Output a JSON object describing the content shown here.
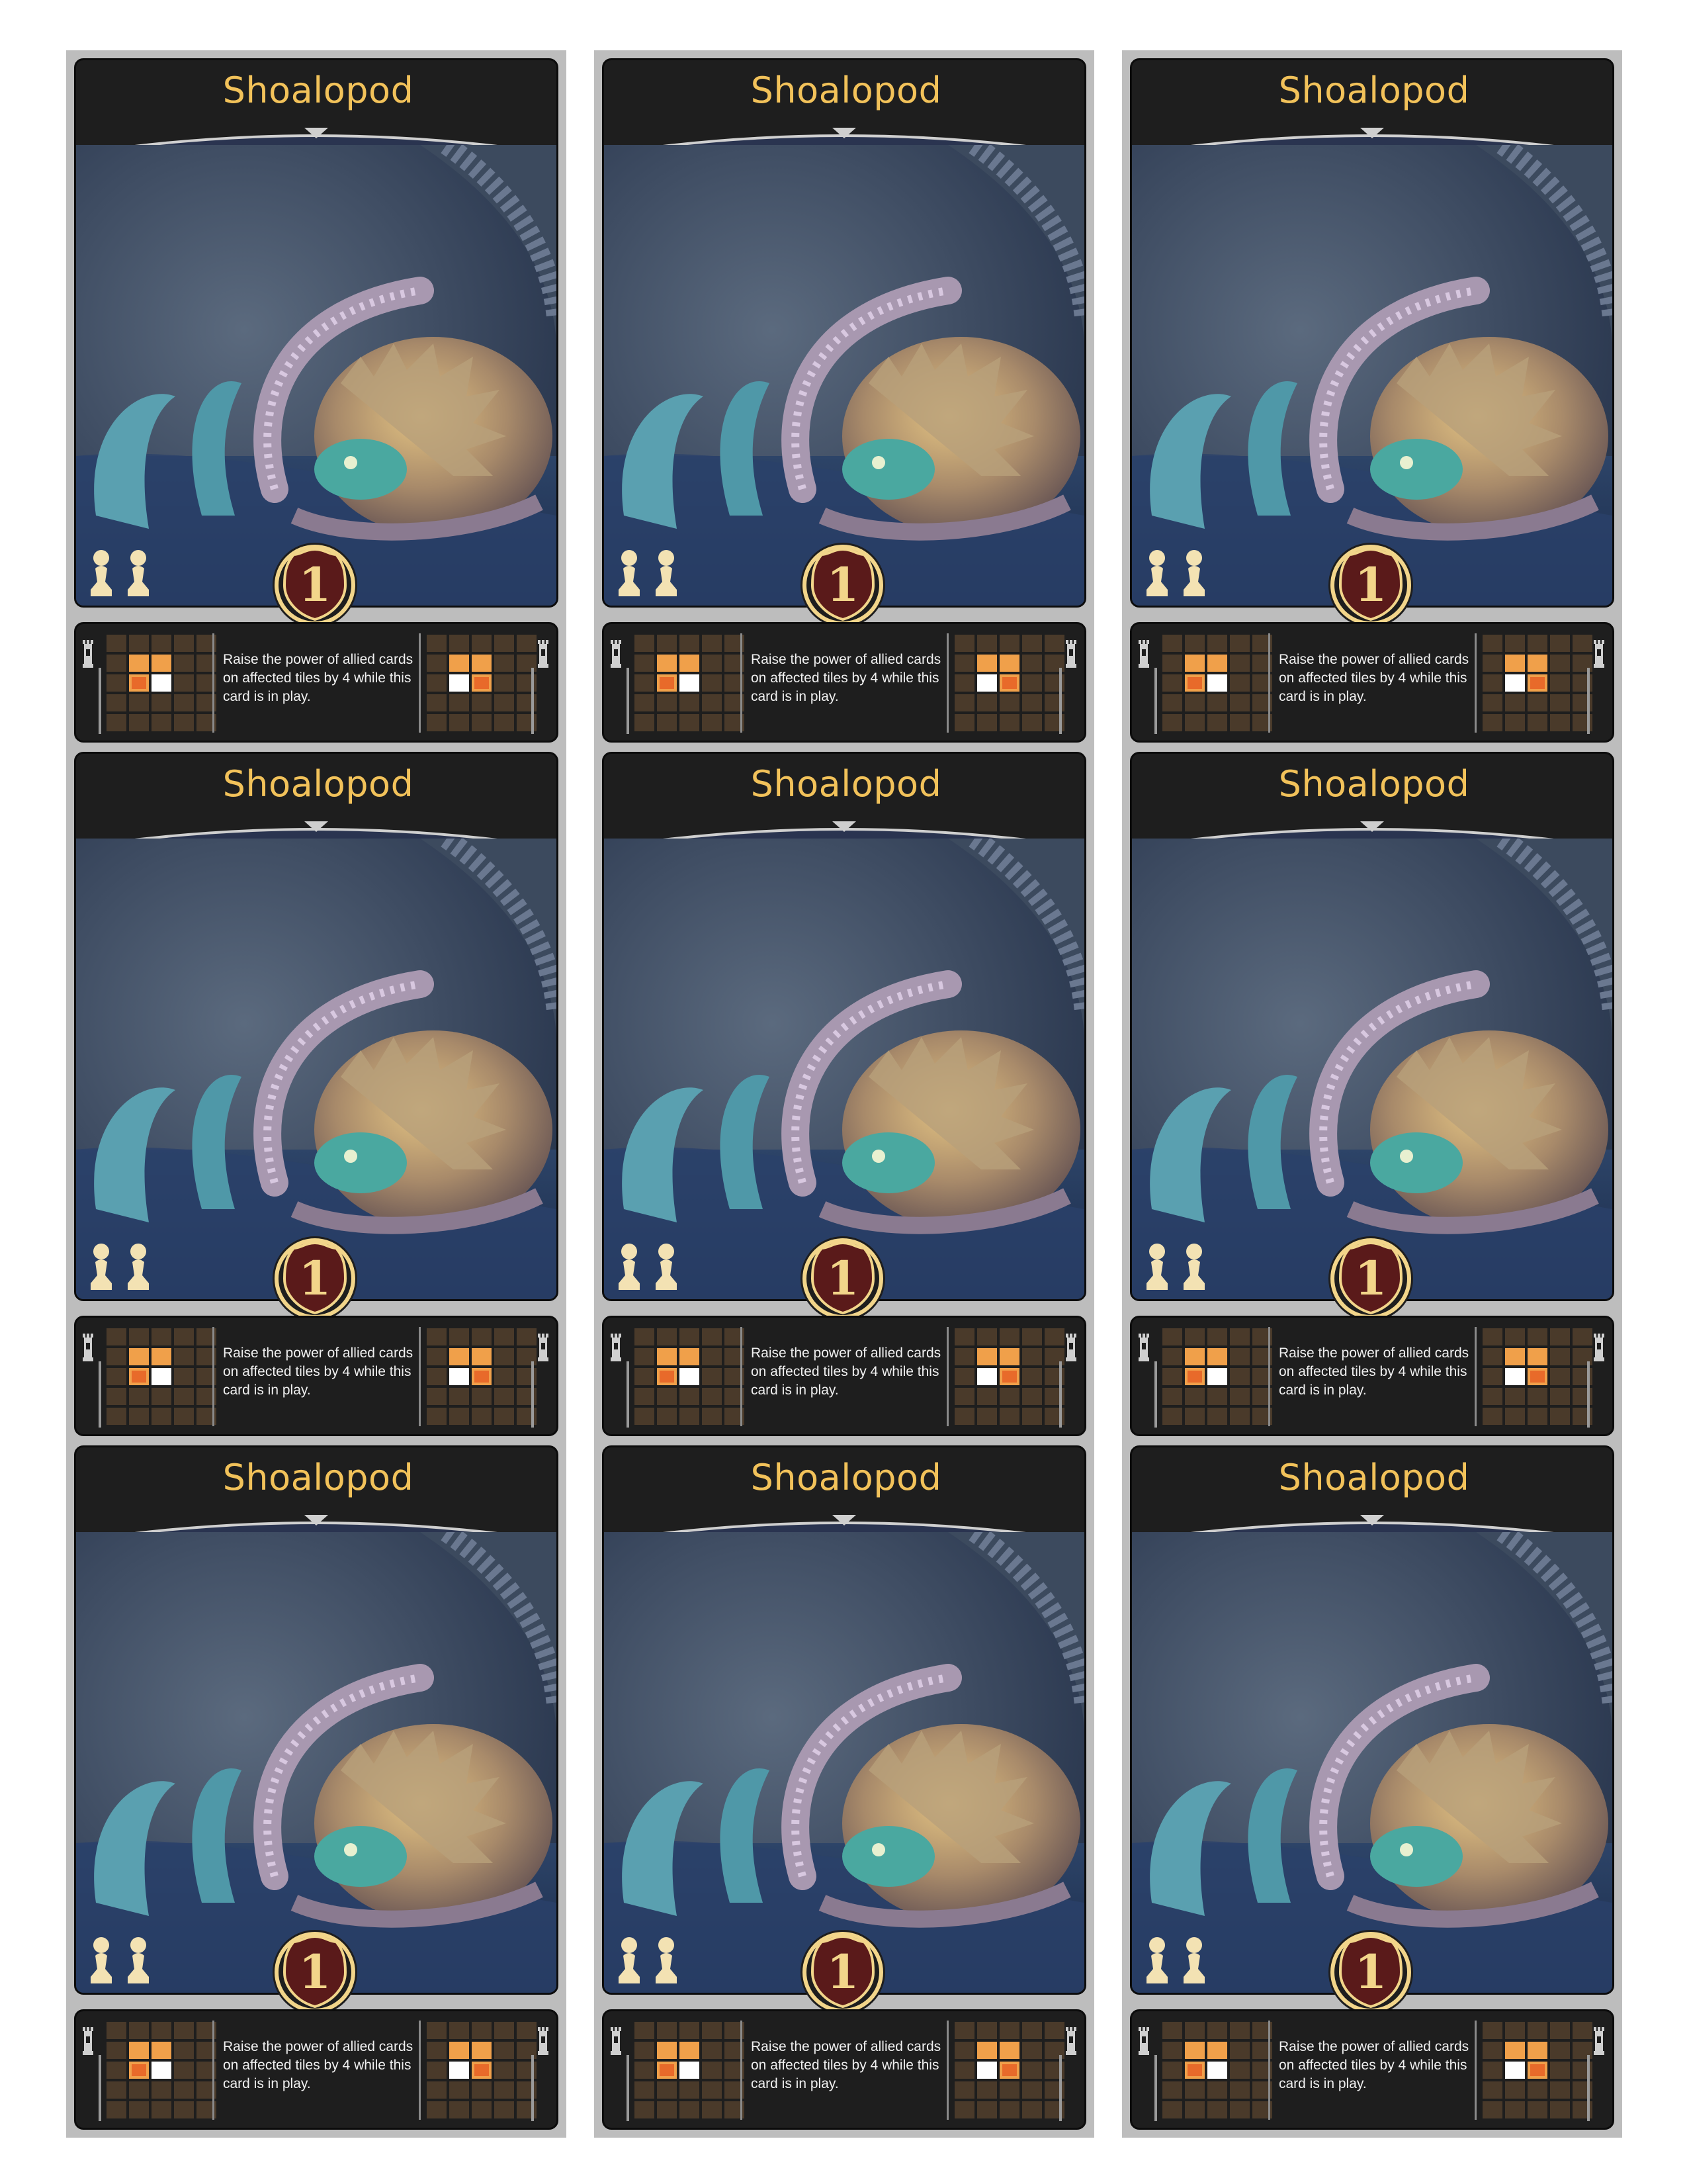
{
  "sheet": {
    "card_name": "Shoalopod",
    "power": "1",
    "description": "Raise the power of allied cards on affected tiles by 4 while this card is in play.",
    "pawn_count": 2,
    "icons": {
      "pawn": "pawn-icon",
      "tower": "tower-icon",
      "power": "power-rank-badge"
    },
    "grid_legend": {
      "active": "#f0a04a",
      "self": "#ffffff",
      "self_active": "#e86a2a",
      "empty": "#4a3a2a"
    },
    "left_grid": [
      [
        0,
        0,
        0,
        0,
        0
      ],
      [
        0,
        1,
        1,
        0,
        0
      ],
      [
        0,
        2,
        3,
        0,
        0
      ],
      [
        0,
        0,
        0,
        0,
        0
      ],
      [
        0,
        0,
        0,
        0,
        0
      ]
    ],
    "right_grid": [
      [
        0,
        0,
        0,
        0,
        0
      ],
      [
        0,
        1,
        1,
        0,
        0
      ],
      [
        0,
        3,
        2,
        0,
        0
      ],
      [
        0,
        0,
        0,
        0,
        0
      ],
      [
        0,
        0,
        0,
        0,
        0
      ]
    ]
  },
  "colors": {
    "title": "#f2c25a",
    "card_bg": "#1e1e1e",
    "column_bg": "#bdbdbd",
    "badge": "#5a1a1a",
    "badge_ring": "#f2d58a"
  }
}
